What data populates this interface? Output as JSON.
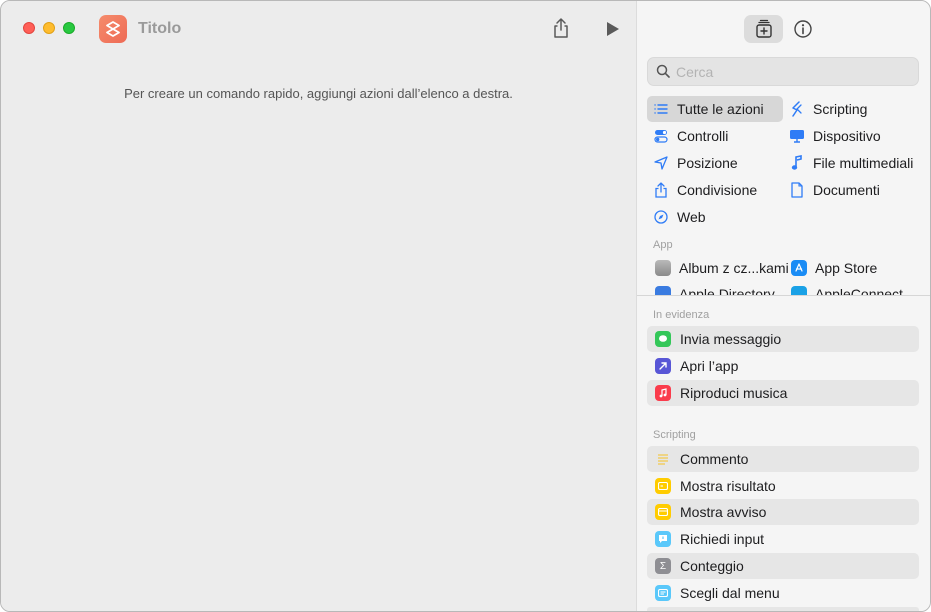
{
  "window": {
    "title": "Titolo"
  },
  "editor": {
    "hint": "Per creare un comando rapido, aggiungi azioni dall’elenco a destra."
  },
  "search": {
    "placeholder": "Cerca"
  },
  "categories": [
    {
      "label": "Tutte le azioni",
      "icon": "list-icon",
      "selected": true
    },
    {
      "label": "Scripting",
      "icon": "scripting-icon"
    },
    {
      "label": "Controlli",
      "icon": "toggle-icon"
    },
    {
      "label": "Dispositivo",
      "icon": "display-icon"
    },
    {
      "label": "Posizione",
      "icon": "location-arrow-icon"
    },
    {
      "label": "File multimediali",
      "icon": "music-note-icon"
    },
    {
      "label": "Condivisione",
      "icon": "share-icon"
    },
    {
      "label": "Documenti",
      "icon": "document-icon"
    },
    {
      "label": "Web",
      "icon": "compass-icon"
    }
  ],
  "apps": {
    "label": "App",
    "items": [
      {
        "label": "Album z cz...kami"
      },
      {
        "label": "App Store"
      },
      {
        "label": "Apple Directory"
      },
      {
        "label": "AppleConnect"
      }
    ]
  },
  "featured": {
    "label": "In evidenza",
    "items": [
      {
        "label": "Invia messaggio",
        "color": "#34c759",
        "icon": "message-icon"
      },
      {
        "label": "Apri l’app",
        "color": "#5856d6",
        "icon": "arrow-up-right-icon"
      },
      {
        "label": "Riproduci musica",
        "color": "#fa3c4c",
        "icon": "music-note-icon"
      }
    ]
  },
  "scripting": {
    "label": "Scripting",
    "items": [
      {
        "label": "Commento",
        "color": "#f5d76e",
        "icon": "comment-lines-icon"
      },
      {
        "label": "Mostra risultato",
        "color": "#ffcc00",
        "icon": "result-icon"
      },
      {
        "label": "Mostra avviso",
        "color": "#ffcc00",
        "icon": "alert-icon"
      },
      {
        "label": "Richiedi input",
        "color": "#5ac8fa",
        "icon": "input-bubble-icon"
      },
      {
        "label": "Conteggio",
        "color": "#8e8e93",
        "icon": "sigma-icon"
      },
      {
        "label": "Scegli dal menu",
        "color": "#5ac8fa",
        "icon": "menu-icon"
      }
    ]
  },
  "colors": {
    "accent": "#2f7cf6",
    "app_icon": "#ee6a55"
  }
}
